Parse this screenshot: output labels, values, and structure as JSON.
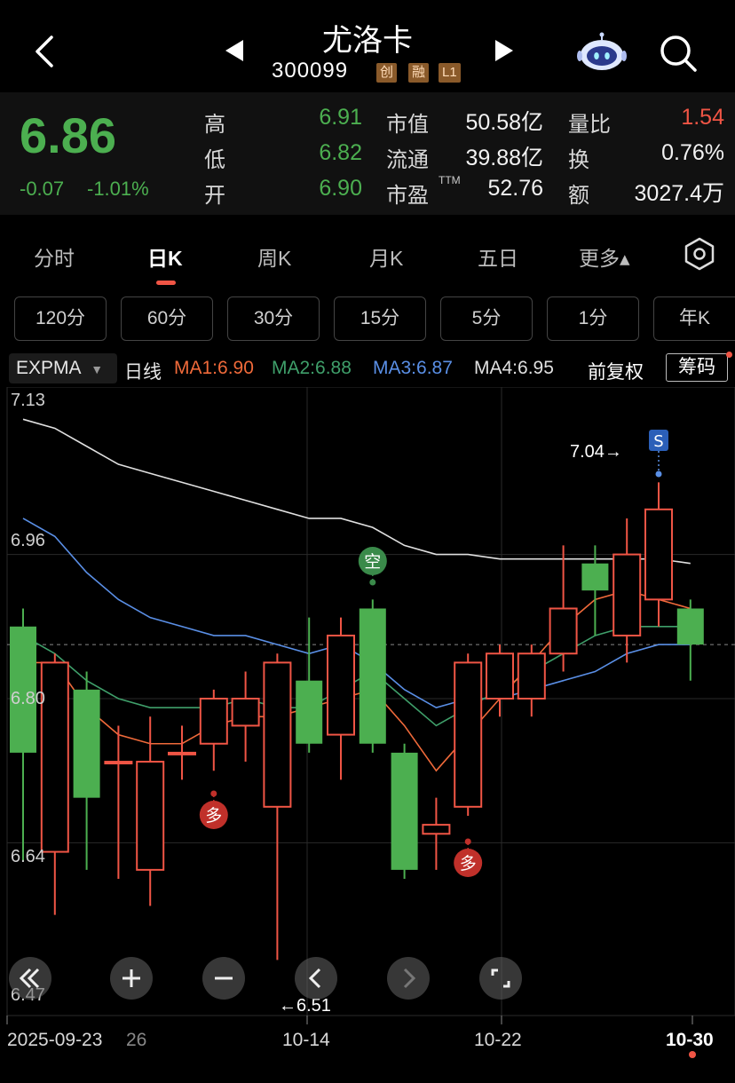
{
  "header": {
    "title": "尤洛卡",
    "code": "300099",
    "tags": [
      "创",
      "融",
      "L1"
    ]
  },
  "quote": {
    "price": "6.86",
    "change": "-0.07",
    "change_pct": "-1.01%",
    "high_label": "高",
    "high": "6.91",
    "low_label": "低",
    "low": "6.82",
    "open_label": "开",
    "open": "6.90",
    "mcap_label": "市值",
    "mcap": "50.58亿",
    "float_label": "流通",
    "float": "39.88亿",
    "pe_label": "市盈",
    "pe_sup": "TTM",
    "pe": "52.76",
    "vol_ratio_label": "量比",
    "vol_ratio": "1.54",
    "turnover_label": "换",
    "turnover": "0.76%",
    "amount_label": "额",
    "amount": "3027.4万"
  },
  "tabs": [
    "分时",
    "日K",
    "周K",
    "月K",
    "五日",
    "更多▴"
  ],
  "periods": [
    "120分",
    "60分",
    "30分",
    "15分",
    "5分",
    "1分",
    "年K"
  ],
  "indicator": {
    "name": "EXPMA",
    "line_label": "日线",
    "ma1": "MA1:6.90",
    "ma2": "MA2:6.88",
    "ma3": "MA3:6.87",
    "ma4": "MA4:6.95",
    "adjust": "前复权",
    "chip_label": "筹码",
    "colors": {
      "ma1": "#f06a3a",
      "ma2": "#3f9f6a",
      "ma3": "#5a8fe6",
      "ma4": "#e0e0e0"
    }
  },
  "chart_data": {
    "type": "candlestick",
    "y_ticks": [
      "7.13",
      "6.96",
      "6.80",
      "6.64",
      "6.47"
    ],
    "x_labels": [
      "2025-09-23",
      "26",
      "10-14",
      "10-22",
      "10-30"
    ],
    "annotations": {
      "high_label": "7.04→",
      "low_label": "←6.51",
      "sell": "S",
      "short": "空",
      "long": "多"
    },
    "candles": [
      {
        "o": 6.88,
        "c": 6.74,
        "h": 6.9,
        "l": 6.62
      },
      {
        "o": 6.63,
        "c": 6.84,
        "h": 6.85,
        "l": 6.56
      },
      {
        "o": 6.81,
        "c": 6.69,
        "h": 6.83,
        "l": 6.61
      },
      {
        "o": 6.73,
        "c": 6.73,
        "h": 6.77,
        "l": 6.6
      },
      {
        "o": 6.61,
        "c": 6.73,
        "h": 6.78,
        "l": 6.57
      },
      {
        "o": 6.74,
        "c": 6.74,
        "h": 6.77,
        "l": 6.71
      },
      {
        "o": 6.75,
        "c": 6.8,
        "h": 6.81,
        "l": 6.72
      },
      {
        "o": 6.77,
        "c": 6.8,
        "h": 6.83,
        "l": 6.73
      },
      {
        "o": 6.68,
        "c": 6.84,
        "h": 6.85,
        "l": 6.51
      },
      {
        "o": 6.82,
        "c": 6.75,
        "h": 6.89,
        "l": 6.74
      },
      {
        "o": 6.76,
        "c": 6.87,
        "h": 6.89,
        "l": 6.71
      },
      {
        "o": 6.9,
        "c": 6.75,
        "h": 6.91,
        "l": 6.74
      },
      {
        "o": 6.74,
        "c": 6.61,
        "h": 6.75,
        "l": 6.6
      },
      {
        "o": 6.65,
        "c": 6.66,
        "h": 6.69,
        "l": 6.61
      },
      {
        "o": 6.68,
        "c": 6.84,
        "h": 6.85,
        "l": 6.67
      },
      {
        "o": 6.8,
        "c": 6.85,
        "h": 6.86,
        "l": 6.78
      },
      {
        "o": 6.8,
        "c": 6.85,
        "h": 6.86,
        "l": 6.78
      },
      {
        "o": 6.85,
        "c": 6.9,
        "h": 6.97,
        "l": 6.83
      },
      {
        "o": 6.95,
        "c": 6.92,
        "h": 6.97,
        "l": 6.87
      },
      {
        "o": 6.87,
        "c": 6.96,
        "h": 7.0,
        "l": 6.84
      },
      {
        "o": 6.91,
        "c": 7.01,
        "h": 7.04,
        "l": 6.88
      },
      {
        "o": 6.9,
        "c": 6.86,
        "h": 6.91,
        "l": 6.82
      }
    ],
    "ma1": [
      6.84,
      6.84,
      6.79,
      6.76,
      6.75,
      6.75,
      6.77,
      6.78,
      6.78,
      6.79,
      6.8,
      6.81,
      6.77,
      6.72,
      6.76,
      6.8,
      6.84,
      6.88,
      6.91,
      6.92,
      6.91,
      6.9
    ],
    "ma2": [
      6.87,
      6.85,
      6.82,
      6.8,
      6.79,
      6.79,
      6.79,
      6.8,
      6.79,
      6.79,
      6.81,
      6.83,
      6.8,
      6.77,
      6.79,
      6.81,
      6.83,
      6.85,
      6.87,
      6.88,
      6.88,
      6.88
    ],
    "ma3": [
      7.0,
      6.98,
      6.94,
      6.91,
      6.89,
      6.88,
      6.87,
      6.87,
      6.86,
      6.85,
      6.86,
      6.84,
      6.81,
      6.79,
      6.8,
      6.8,
      6.81,
      6.82,
      6.83,
      6.85,
      6.86,
      6.86
    ],
    "ma4": [
      7.11,
      7.1,
      7.08,
      7.06,
      7.05,
      7.04,
      7.03,
      7.02,
      7.01,
      7.0,
      7.0,
      6.99,
      6.97,
      6.96,
      6.96,
      6.955,
      6.955,
      6.955,
      6.955,
      6.955,
      6.955,
      6.95
    ],
    "ylim": [
      6.47,
      7.13
    ]
  }
}
